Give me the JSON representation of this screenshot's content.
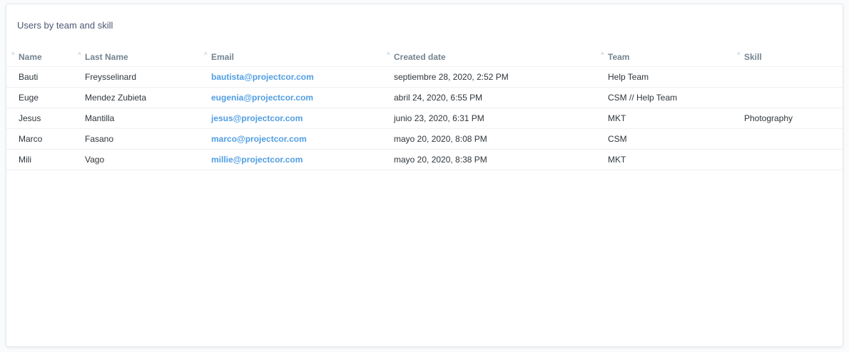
{
  "card": {
    "title": "Users by team and skill"
  },
  "table": {
    "columns": [
      "Name",
      "Last Name",
      "Email",
      "Created date",
      "Team",
      "Skill"
    ],
    "sort_icon": "^",
    "rows": [
      {
        "name": "Bauti",
        "last": "Freysselinard",
        "email": "bautista@projectcor.com",
        "date": "septiembre 28, 2020, 2:52 PM",
        "team": "Help Team",
        "skill": ""
      },
      {
        "name": "Euge",
        "last": "Mendez Zubieta",
        "email": "eugenia@projectcor.com",
        "date": "abril 24, 2020, 6:55 PM",
        "team": "CSM // Help Team",
        "skill": ""
      },
      {
        "name": "Jesus",
        "last": "Mantilla",
        "email": "jesus@projectcor.com",
        "date": "junio 23, 2020, 6:31 PM",
        "team": "MKT",
        "skill": "Photography"
      },
      {
        "name": "Marco",
        "last": "Fasano",
        "email": "marco@projectcor.com",
        "date": "mayo 20, 2020, 8:08 PM",
        "team": "CSM",
        "skill": ""
      },
      {
        "name": "Mili",
        "last": "Vago",
        "email": "millie@projectcor.com",
        "date": "mayo 20, 2020, 8:38 PM",
        "team": "MKT",
        "skill": ""
      }
    ]
  },
  "colors": {
    "link": "#509ee3",
    "header_text": "#74838f",
    "title_text": "#4c5773"
  }
}
